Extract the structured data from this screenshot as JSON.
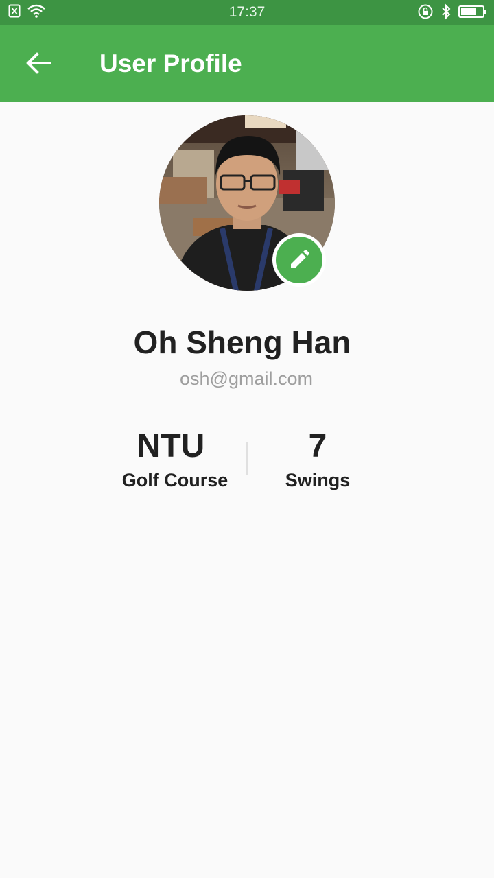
{
  "status_bar": {
    "time": "17:37",
    "icons": [
      "sim-x-icon",
      "wifi-icon",
      "lock-rotation-icon",
      "bluetooth-icon",
      "battery-icon"
    ]
  },
  "app_bar": {
    "title": "User Profile",
    "back_icon": "arrow-left-icon"
  },
  "profile": {
    "name": "Oh Sheng Han",
    "email": "osh@gmail.com",
    "avatar_alt": "profile photo",
    "edit_icon": "pencil-icon"
  },
  "stats": {
    "course": {
      "value": "NTU",
      "label": "Golf Course"
    },
    "swings": {
      "value": "7",
      "label": "Swings"
    }
  },
  "colors": {
    "status_bar": "#3d9443",
    "app_bar": "#4caf50",
    "accent": "#4caf50",
    "background": "#fafafa",
    "text_primary": "#212121",
    "text_secondary": "#9e9e9e"
  }
}
